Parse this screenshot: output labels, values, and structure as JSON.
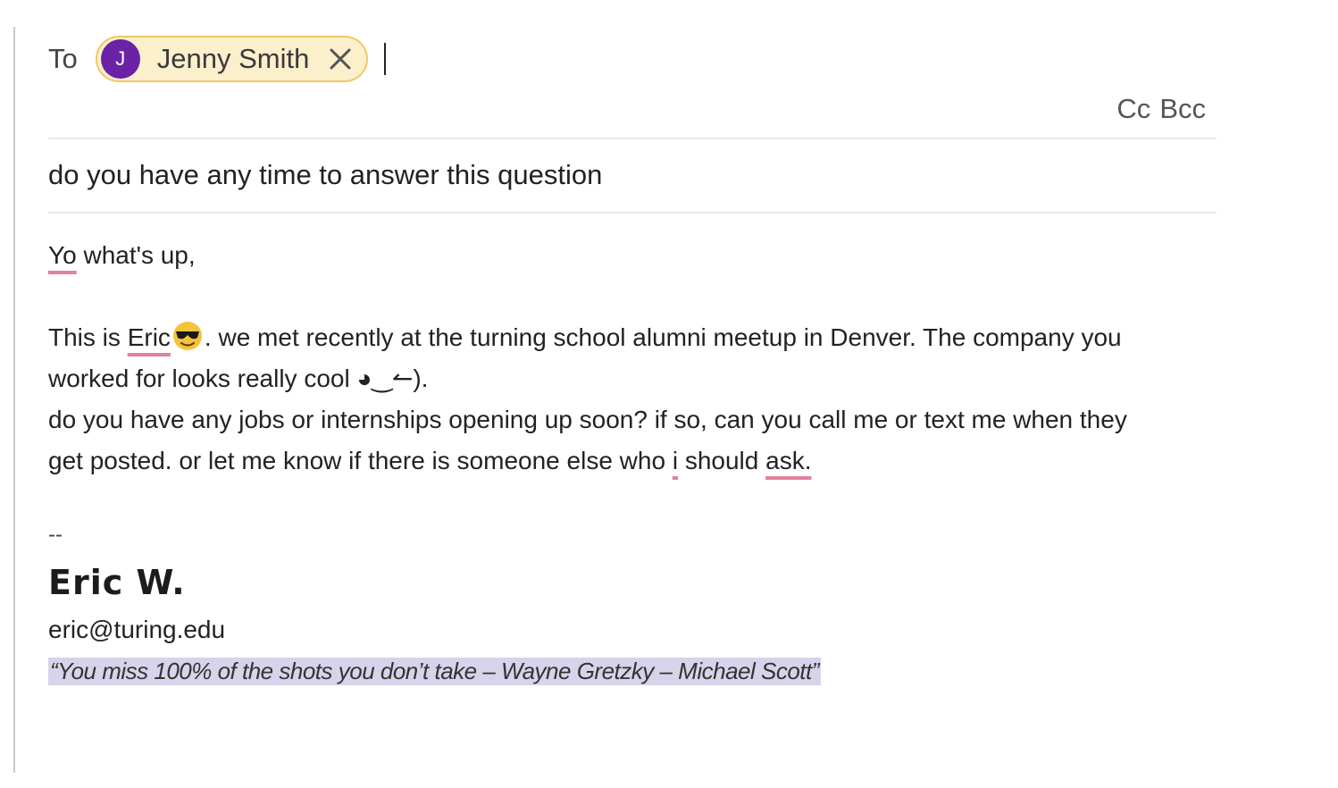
{
  "to": {
    "label": "To",
    "recipient": {
      "initial": "J",
      "name": "Jenny Smith",
      "avatar_color": "#6a22a6",
      "chip_color": "#fcefcc"
    },
    "remove_icon": "close-icon"
  },
  "cc_label": "Cc",
  "bcc_label": "Bcc",
  "subject": "do you have any time to answer this question",
  "body": {
    "greeting_word": "Yo",
    "greeting_rest": " what's up,",
    "l1_a": "This is ",
    "l1_name": "Eric",
    "l1_emoji": "smiling-face-with-sunglasses",
    "l1_b": ". we met recently at the turning school alumni meetup in Denver. The company you",
    "l2": "worked for looks really cool ◕‿↼).",
    "l3": "do you have any jobs or internships opening up soon? if so, can you call me or text me when they",
    "l4_a": "get posted. or let me know if there is someone else who ",
    "l4_i": "i",
    "l4_b": " should ",
    "l4_ask": "ask."
  },
  "signature": {
    "dashes": "--",
    "name": "Eric W.",
    "email": "eric@turing.edu",
    "quote": "“You miss 100% of the shots you don’t take – Wayne Gretzky – Michael Scott”"
  }
}
